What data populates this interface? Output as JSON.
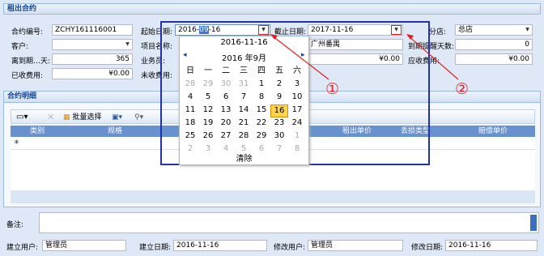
{
  "header": {
    "title": "租出合约"
  },
  "fields": {
    "contract_no": {
      "label": "合约编号:",
      "value": "ZCHY161116001"
    },
    "start_date": {
      "label": "起始日期:",
      "value_pre": "2016-",
      "value_sel": "09",
      "value_post": "-16"
    },
    "end_date": {
      "label": "截止日期:",
      "value": "2017-11-16"
    },
    "branch": {
      "label": "分店:",
      "value": "总店"
    },
    "customer": {
      "label": "客户:",
      "value": ""
    },
    "project": {
      "label": "项目名称:",
      "value": "广州番禺"
    },
    "remind_days": {
      "label": "到期提醒天数:",
      "value": "0"
    },
    "days_left": {
      "label": "离到期…天:",
      "value": "365"
    },
    "salesman": {
      "label": "业务员:"
    },
    "fee1": {
      "value": "¥0.00"
    },
    "receivable": {
      "label": "应收费用:",
      "value": "¥0.00"
    },
    "received": {
      "label": "已收费用:",
      "value": "¥0.00"
    },
    "unreceived": {
      "label": "未收费用:"
    }
  },
  "calendar": {
    "today": "2016-11-16",
    "month_title": "2016 年9月",
    "prev": "◂",
    "next": "▸",
    "weekdays": [
      "日",
      "一",
      "二",
      "三",
      "四",
      "五",
      "六"
    ],
    "weeks": [
      [
        "28",
        "29",
        "30",
        "31",
        "1",
        "2",
        "3"
      ],
      [
        "4",
        "5",
        "6",
        "7",
        "8",
        "9",
        "10"
      ],
      [
        "11",
        "12",
        "13",
        "14",
        "15",
        "16",
        "17"
      ],
      [
        "18",
        "19",
        "20",
        "21",
        "22",
        "23",
        "24"
      ],
      [
        "25",
        "26",
        "27",
        "28",
        "29",
        "30",
        "1"
      ],
      [
        "2",
        "3",
        "4",
        "5",
        "6",
        "7",
        "8"
      ]
    ],
    "selected": "16",
    "clear": "清除"
  },
  "detail": {
    "title": "合约明细",
    "toolbar": {
      "batch_label": "批量选择"
    },
    "columns": [
      "类别",
      "规格",
      "租出单价",
      "丢损类型",
      "赔偿单价"
    ]
  },
  "annotations": [
    "①",
    "②"
  ],
  "footer": {
    "remark_label": "备注:",
    "create_user_label": "建立用户:",
    "create_user": "管理员",
    "create_date_label": "建立日期:",
    "create_date": "2016-11-16",
    "modify_user_label": "修改用户:",
    "modify_user": "管理员",
    "modify_date_label": "修改日期:",
    "modify_date": "2016-11-16"
  },
  "colors": {
    "header_text": "#15428b",
    "grid_header": "#6892cf",
    "annotation": "#e02020",
    "highlight_border": "#2233aa",
    "selected_day": "#ffd44a"
  }
}
